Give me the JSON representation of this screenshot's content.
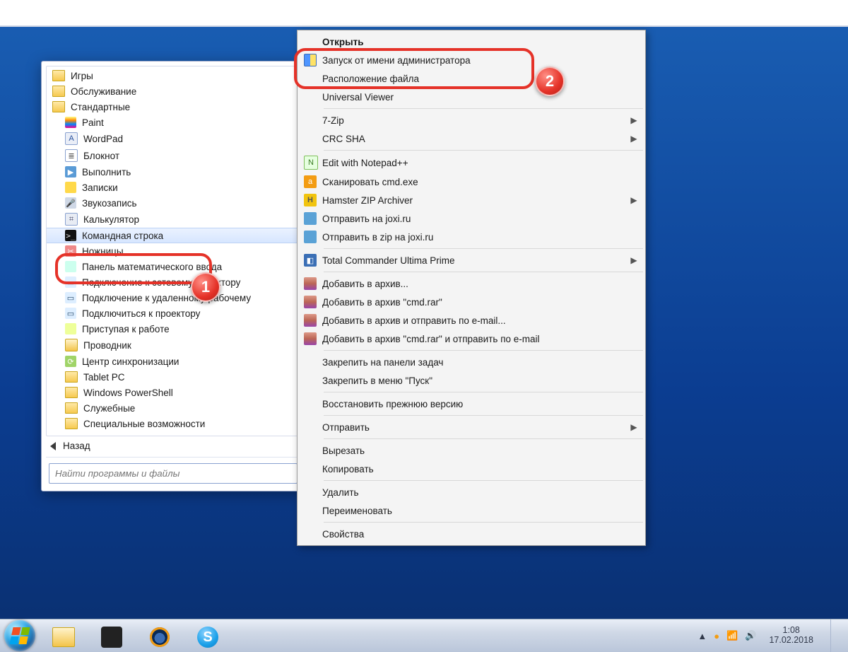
{
  "startmenu": {
    "folders": {
      "games": "Игры",
      "maintenance": "Обслуживание",
      "accessories": "Стандартные"
    },
    "accessories": {
      "paint": "Paint",
      "wordpad": "WordPad",
      "notepad": "Блокнот",
      "run": "Выполнить",
      "stickynotes": "Записки",
      "soundrec": "Звукозапись",
      "calc": "Калькулятор",
      "cmd": "Командная строка",
      "snip": "Ножницы",
      "mathinput": "Панель математического ввода",
      "netproj": "Подключение к сетевому проектору",
      "rdp": "Подключение к удаленному рабочему",
      "projector": "Подключиться к проектору",
      "getstarted": "Приступая к работе",
      "explorer": "Проводник",
      "sync": "Центр синхронизации"
    },
    "subfolders": {
      "tabletpc": "Tablet PC",
      "powershell": "Windows PowerShell",
      "systools": "Служебные",
      "easeofaccess": "Специальные возможности"
    },
    "back": "Назад",
    "search_placeholder": "Найти программы и файлы"
  },
  "contextmenu": {
    "open": "Открыть",
    "runas": "Запуск от имени администратора",
    "filelocation": "Расположение файла",
    "uviewer": "Universal Viewer",
    "sevenzip": "7-Zip",
    "crcsha": "CRC SHA",
    "editnpp": "Edit with Notepad++",
    "avscan": "Сканировать cmd.exe",
    "hamster": "Hamster ZIP Archiver",
    "joxi": "Отправить на joxi.ru",
    "joxizip": "Отправить в zip на joxi.ru",
    "tcup": "Total Commander Ultima Prime",
    "rar_add": "Добавить в архив...",
    "rar_addname": "Добавить в архив \"cmd.rar\"",
    "rar_addmail": "Добавить в архив и отправить по e-mail...",
    "rar_addnamemail": "Добавить в архив \"cmd.rar\" и отправить по e-mail",
    "pintaskbar": "Закрепить на панели задач",
    "pinstart": "Закрепить в меню \"Пуск\"",
    "restorever": "Восстановить прежнюю версию",
    "sendto": "Отправить",
    "cut": "Вырезать",
    "copy": "Копировать",
    "delete": "Удалить",
    "rename": "Переименовать",
    "properties": "Свойства"
  },
  "taskbar": {
    "time": "1:08",
    "date": "17.02.2018"
  },
  "callouts": {
    "one": "1",
    "two": "2"
  }
}
